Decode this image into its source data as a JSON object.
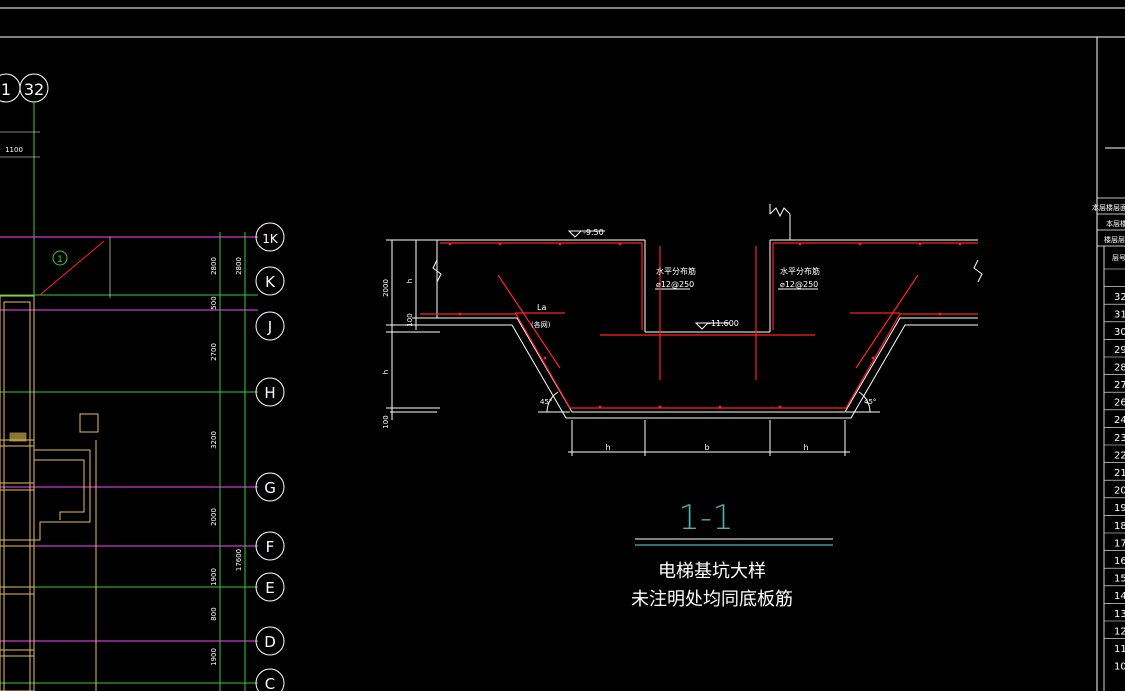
{
  "colors": {
    "background": "#000000",
    "line_white": "#ffffff",
    "grid_green": "#33cc33",
    "grid_magenta": "#ff44ff",
    "wall_yellow": "#e6c15a",
    "rebar_red": "#ff2020",
    "section_title": "#4fb0b0"
  },
  "plan": {
    "axis_top": [
      "1",
      "32"
    ],
    "top_dim": "1100",
    "note_bubble": "1",
    "axes_right": [
      "1K",
      "K",
      "J",
      "H",
      "G",
      "F",
      "E",
      "D",
      "C"
    ],
    "dims_outer": [
      "2800",
      "2800"
    ],
    "dims_inner": [
      "500",
      "2700",
      "3200",
      "2000",
      "1900",
      "800",
      "1900"
    ],
    "dim_total": "17600"
  },
  "section": {
    "top_level": "-9.50",
    "bottom_level": "-11.600",
    "rebar_left": [
      "水平分布筋",
      "⌀12@250"
    ],
    "rebar_right": [
      "水平分布筋",
      "⌀12@250"
    ],
    "la_label": "La",
    "la_note": "(各网)",
    "dim_left": [
      "2000",
      "h",
      "100",
      "h",
      "100"
    ],
    "dim_bottom": [
      "h",
      "b",
      "h"
    ],
    "angle_left": "45°",
    "angle_right": "45°"
  },
  "title": {
    "number": "1-1",
    "line1": "电梯基坑大样",
    "line2": "未注明处均同底板筋"
  },
  "table": {
    "header": [
      "本层楼层面",
      "本层楼层",
      "楼层层高"
    ],
    "col_head": "层号",
    "rows": [
      "32",
      "31",
      "30",
      "29",
      "28",
      "27",
      "26",
      "24",
      "23",
      "22",
      "21",
      "20",
      "19",
      "18",
      "17",
      "16",
      "15",
      "14",
      "13",
      "12",
      "11",
      "10"
    ]
  }
}
